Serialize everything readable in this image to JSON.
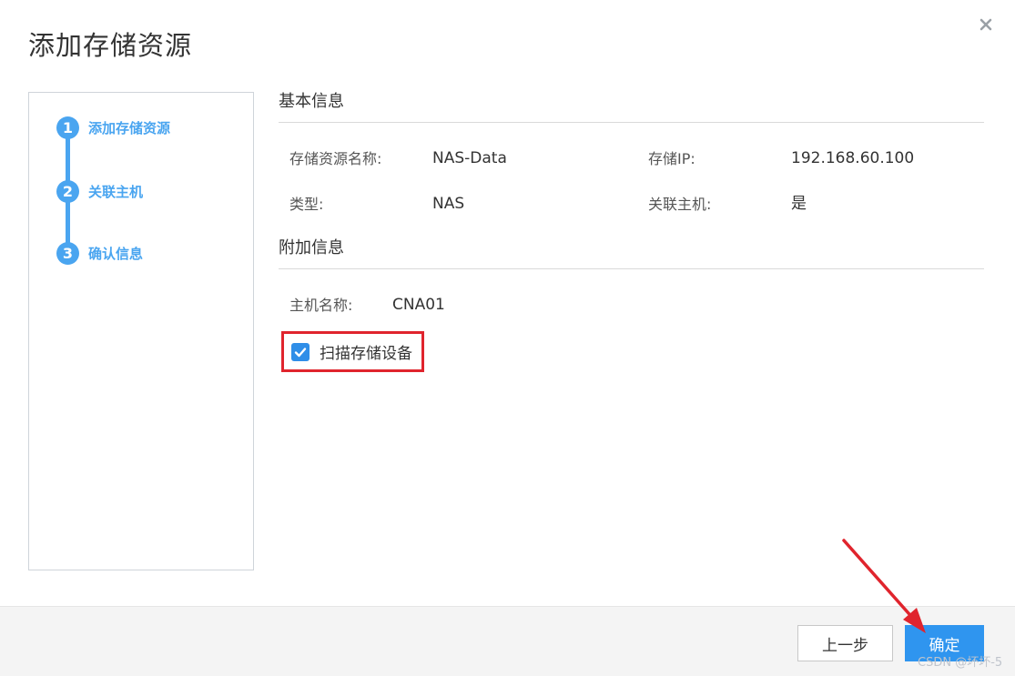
{
  "dialog": {
    "title": "添加存储资源"
  },
  "steps": [
    {
      "number": "1",
      "label": "添加存储资源",
      "state": "active"
    },
    {
      "number": "2",
      "label": "关联主机",
      "state": "active"
    },
    {
      "number": "3",
      "label": "确认信息",
      "state": "active"
    }
  ],
  "basic_info": {
    "title": "基本信息",
    "name_label": "存储资源名称:",
    "name_value": "NAS-Data",
    "ip_label": "存储IP:",
    "ip_value": "192.168.60.100",
    "type_label": "类型:",
    "type_value": "NAS",
    "host_label": "关联主机:",
    "host_value": "是"
  },
  "extra_info": {
    "title": "附加信息",
    "hostname_label": "主机名称:",
    "hostname_value": "CNA01",
    "scan_label": "扫描存储设备",
    "scan_checked": true
  },
  "footer": {
    "prev_label": "上一步",
    "ok_label": "确定"
  },
  "watermark": "CSDN @坏坏-5",
  "colors": {
    "accent": "#4aa5f0",
    "primary_button": "#2f95ef",
    "highlight_box": "#e0242d"
  },
  "icons": {
    "close": "close-icon",
    "check": "check-icon"
  }
}
